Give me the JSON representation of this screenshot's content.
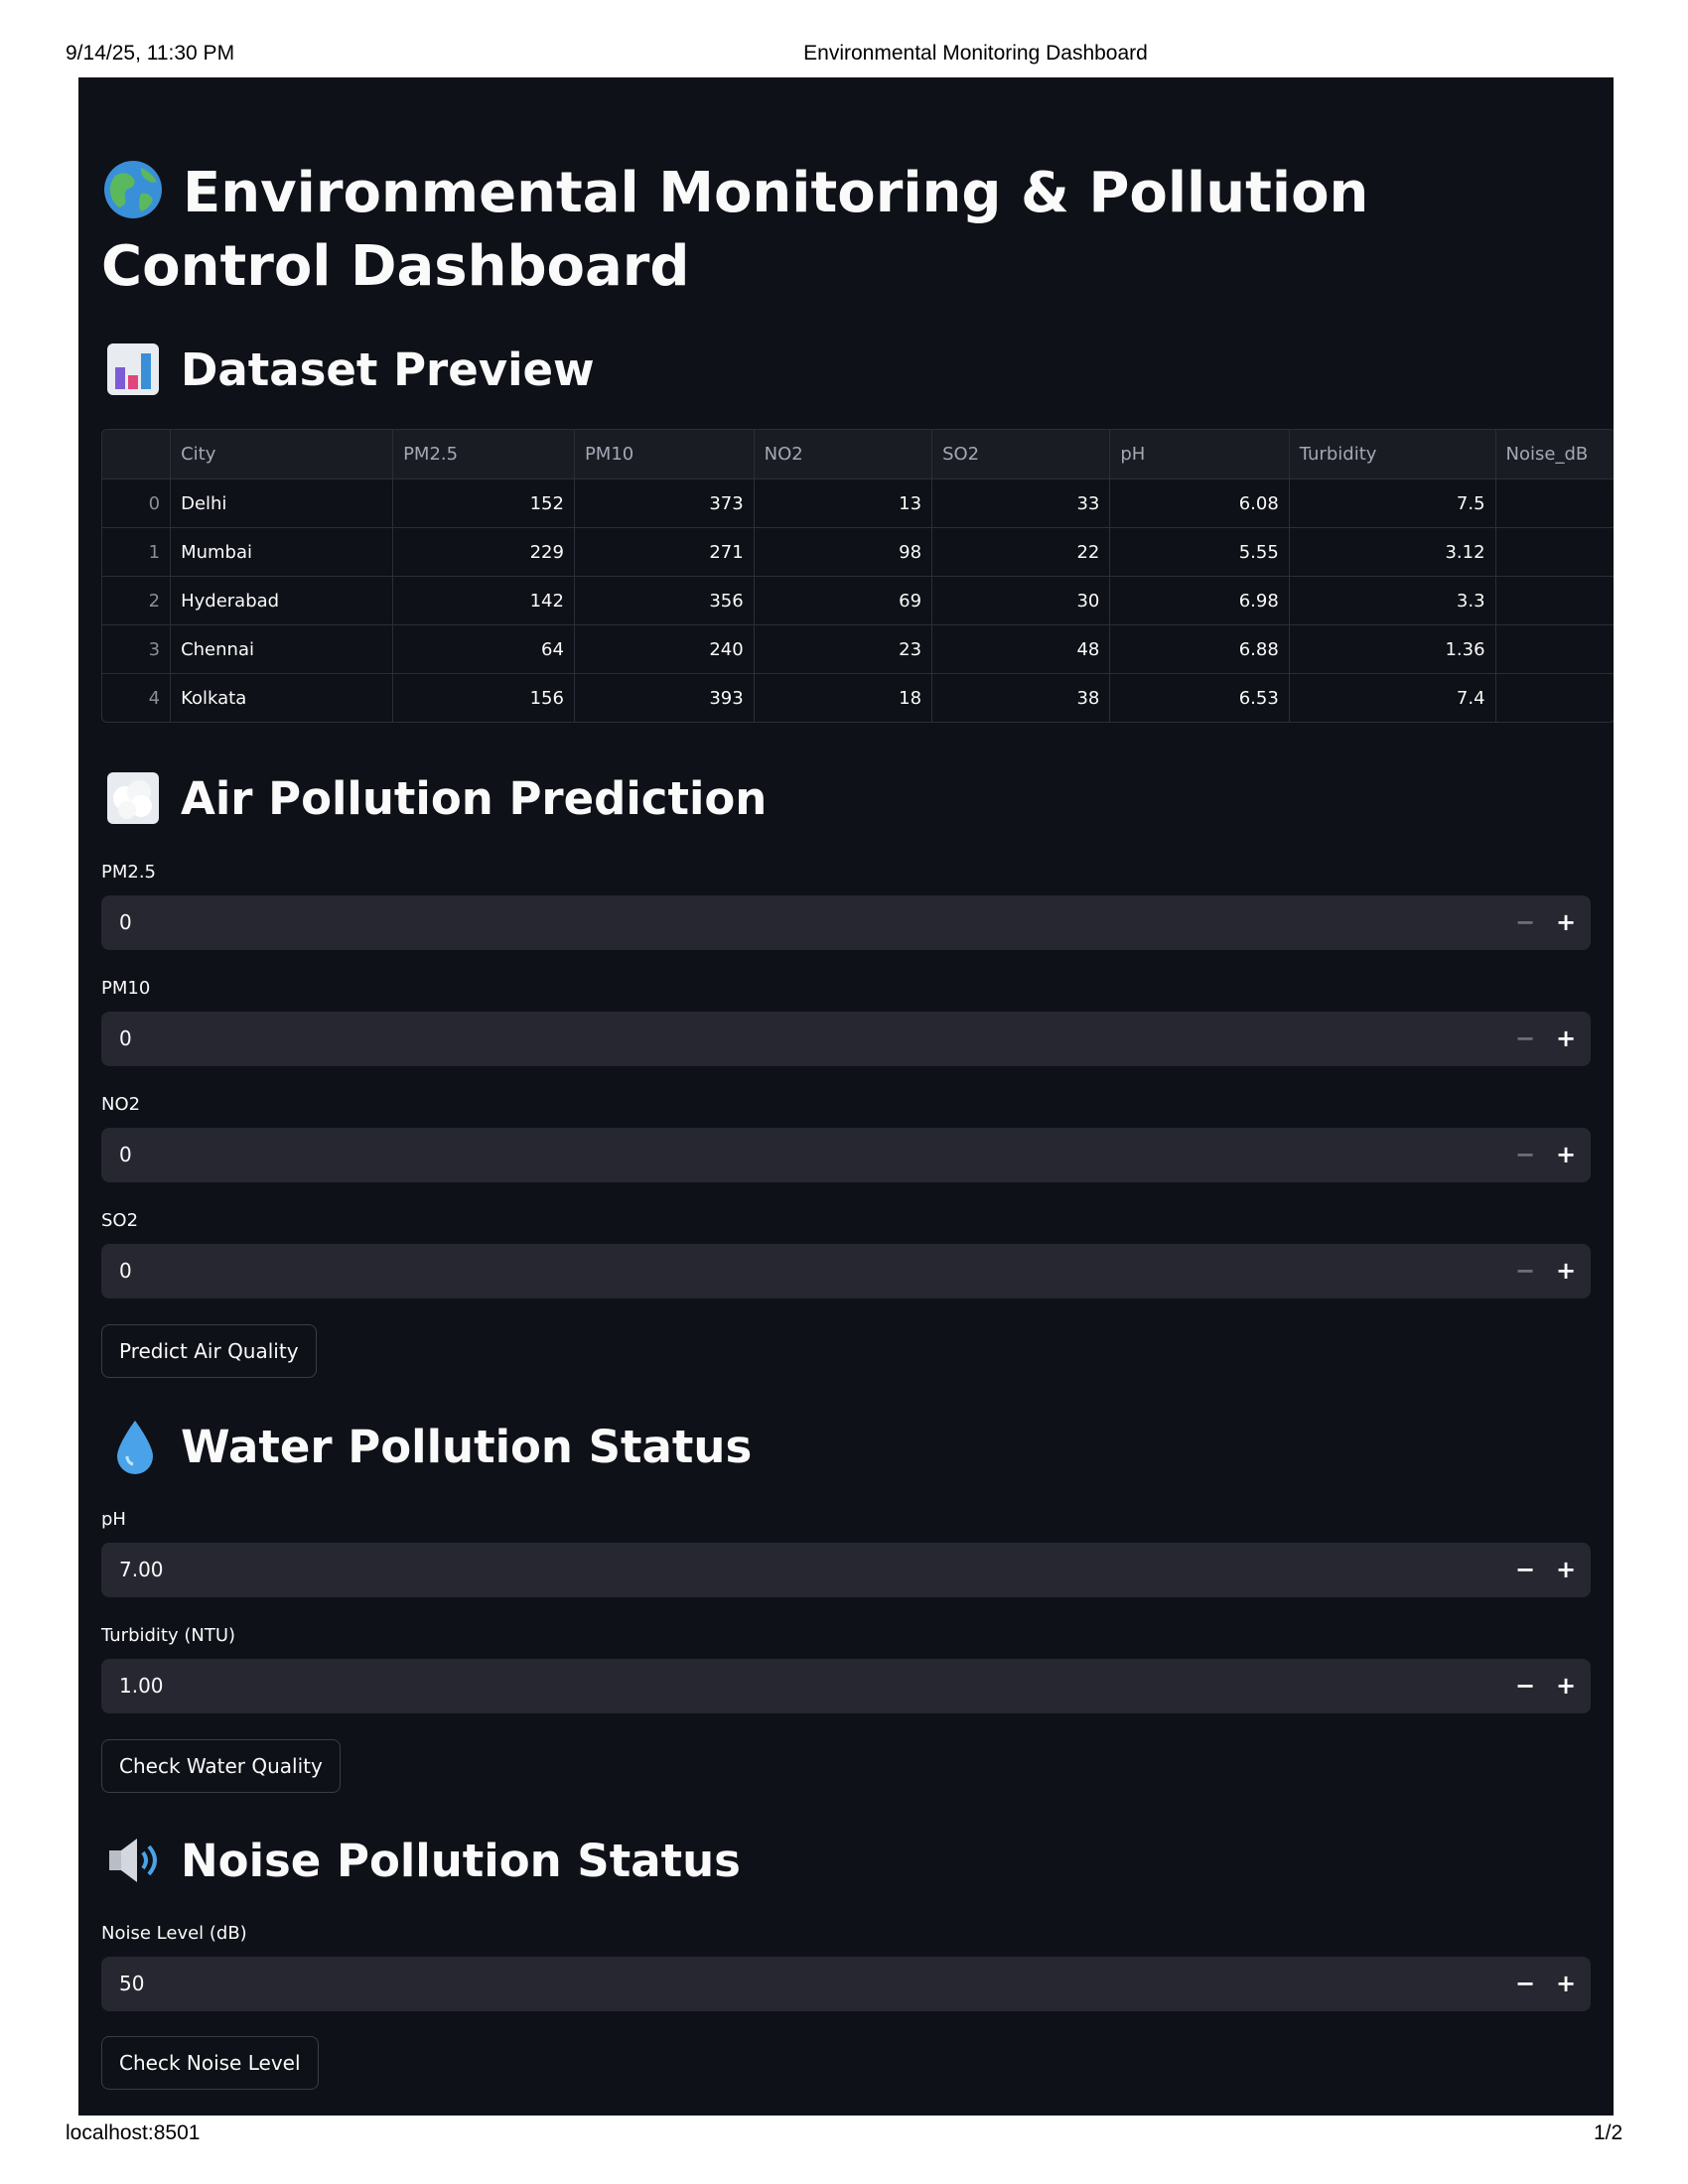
{
  "print_header": {
    "datetime": "9/14/25, 11:30 PM",
    "title": "Environmental Monitoring Dashboard"
  },
  "print_footer": {
    "url": "localhost:8501",
    "page": "1/2"
  },
  "title": "Environmental Monitoring & Pollution Control Dashboard",
  "dataset": {
    "heading": "Dataset Preview",
    "icon": "bar-chart-icon",
    "columns": [
      "City",
      "PM2.5",
      "PM10",
      "NO2",
      "SO2",
      "pH",
      "Turbidity",
      "Noise_dB"
    ],
    "rows": [
      {
        "index": "0",
        "values": [
          "Delhi",
          "152",
          "373",
          "13",
          "33",
          "6.08",
          "7.5",
          ""
        ]
      },
      {
        "index": "1",
        "values": [
          "Mumbai",
          "229",
          "271",
          "98",
          "22",
          "5.55",
          "3.12",
          ""
        ]
      },
      {
        "index": "2",
        "values": [
          "Hyderabad",
          "142",
          "356",
          "69",
          "30",
          "6.98",
          "3.3",
          ""
        ]
      },
      {
        "index": "3",
        "values": [
          "Chennai",
          "64",
          "240",
          "23",
          "48",
          "6.88",
          "1.36",
          ""
        ]
      },
      {
        "index": "4",
        "values": [
          "Kolkata",
          "156",
          "393",
          "18",
          "38",
          "6.53",
          "7.4",
          ""
        ]
      }
    ]
  },
  "air": {
    "heading": "Air Pollution Prediction",
    "icon": "fog-icon",
    "inputs": [
      {
        "label": "PM2.5",
        "value": "0"
      },
      {
        "label": "PM10",
        "value": "0"
      },
      {
        "label": "NO2",
        "value": "0"
      },
      {
        "label": "SO2",
        "value": "0"
      }
    ],
    "button": "Predict Air Quality"
  },
  "water": {
    "heading": "Water Pollution Status",
    "icon": "droplet-icon",
    "inputs": [
      {
        "label": "pH",
        "value": "7.00"
      },
      {
        "label": "Turbidity (NTU)",
        "value": "1.00"
      }
    ],
    "button": "Check Water Quality"
  },
  "noise": {
    "heading": "Noise Pollution Status",
    "icon": "speaker-icon",
    "inputs": [
      {
        "label": "Noise Level (dB)",
        "value": "50"
      }
    ],
    "button": "Check Noise Level"
  },
  "stepper": {
    "minus": "−",
    "plus": "+"
  },
  "colors": {
    "background": "#0e1117",
    "input": "#262730",
    "text": "#fafafa"
  }
}
